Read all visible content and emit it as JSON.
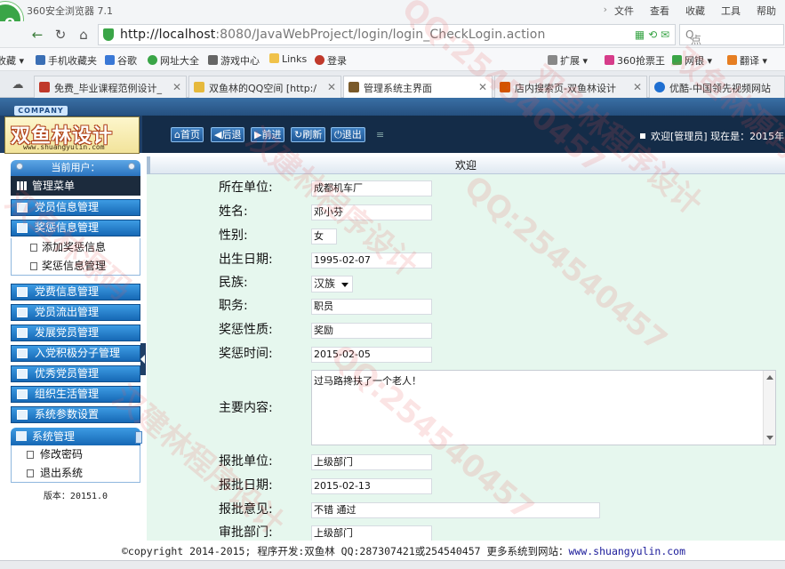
{
  "browser": {
    "logo_letter": "e",
    "app_title": "360安全浏览器 7.1",
    "menus": [
      "文件",
      "查看",
      "收藏",
      "工具",
      "帮助"
    ],
    "url_host": "http://localhost",
    "url_rest": ":8080/JavaWebProject/login/login_CheckLogin.action",
    "search_placeholder": "点此搜索",
    "bookmarks": [
      "收藏",
      "手机收藏夹",
      "谷歌",
      "网址大全",
      "游戏中心",
      "Links",
      "登录",
      "扩展",
      "360抢票王",
      "网银",
      "翻译"
    ],
    "tabs": [
      {
        "label": "免费_毕业课程范例设计_"
      },
      {
        "label": "双鱼林的QQ空间 [http:/"
      },
      {
        "label": "管理系统主界面"
      },
      {
        "label": "店内搜索页-双鱼林设计"
      },
      {
        "label": "优酷-中国领先视频网站"
      }
    ]
  },
  "header": {
    "company_tag": "COMPANY",
    "logo_text": "双鱼林设计",
    "logo_site": "www.shuangyulin.com",
    "toolbar": [
      "首页",
      "后退",
      "前进",
      "刷新",
      "退出"
    ],
    "welcome": "欢迎[管理员]  现在是：2015年"
  },
  "sidebar": {
    "current_user": "当前用户：",
    "menu_head": "管理菜单",
    "items": [
      {
        "label": "党员信息管理"
      },
      {
        "label": "奖惩信息管理"
      },
      {
        "label": "党费信息管理"
      },
      {
        "label": "党员流出管理"
      },
      {
        "label": "发展党员管理"
      },
      {
        "label": "入党积极分子管理"
      },
      {
        "label": "优秀党员管理"
      },
      {
        "label": "组织生活管理"
      },
      {
        "label": "系统参数设置"
      }
    ],
    "sub_items": [
      "添加奖惩信息",
      "奖惩信息管理"
    ],
    "sys_head": "系统管理",
    "sys_items": [
      "修改密码",
      "退出系统"
    ],
    "version": "版本：20151.0"
  },
  "main": {
    "title": "欢迎",
    "form": {
      "unit_label": "所在单位:",
      "unit_value": "成都机车厂",
      "name_label": "姓名:",
      "name_value": "邓小芬",
      "gender_label": "性别:",
      "gender_value": "女",
      "birth_label": "出生日期:",
      "birth_value": "1995-02-07",
      "nation_label": "民族:",
      "nation_value": "汉族",
      "duty_label": "职务:",
      "duty_value": "职员",
      "nature_label": "奖惩性质:",
      "nature_value": "奖励",
      "time_label": "奖惩时间:",
      "time_value": "2015-02-05",
      "content_label": "主要内容:",
      "content_value": "过马路搀扶了一个老人！",
      "approve_unit_label": "报批单位:",
      "approve_unit_value": "上级部门",
      "approve_date_label": "报批日期:",
      "approve_date_value": "2015-02-13",
      "opinion_label": "报批意见:",
      "opinion_value": "不错 通过",
      "dept_label": "审批部门:",
      "dept_value": "上级部门"
    }
  },
  "footer": {
    "text": "©copyright 2014-2015; 程序开发:双鱼林  QQ:287307421或254540457  更多系统到网站：",
    "link": "www.shuangyulin.com"
  },
  "watermarks": [
    "QQ:254540457",
    "双鱼林程序设计",
    "双鱼林源码",
    "汉建林程序设计",
    "QQ:254540457",
    "双鱼林源码",
    "QQ:254540457",
    "汉建林程序设计"
  ]
}
